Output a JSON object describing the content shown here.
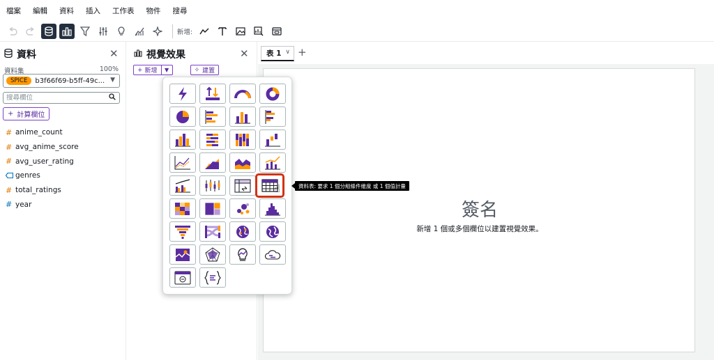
{
  "menu": [
    "檔案",
    "編輯",
    "資料",
    "插入",
    "工作表",
    "物件",
    "搜尋"
  ],
  "toolbar": {
    "new_label": "新增:",
    "icons": [
      "undo-icon",
      "redo-icon",
      "data-icon",
      "visualize-icon",
      "filter-icon",
      "parameters-icon",
      "insights-icon",
      "forecast-icon",
      "ai-icon"
    ],
    "add_icons": [
      "line-chart-icon",
      "text-icon",
      "image-icon",
      "insight-icon",
      "embed-icon"
    ]
  },
  "data_panel": {
    "title": "資料",
    "dataset_label": "資料集",
    "dataset_pct": "100%",
    "spice_badge": "SPICE",
    "dataset_name": "b3f66f69-b5ff-49c...",
    "search_placeholder": "搜尋欄位",
    "calc_button": "計算欄位",
    "fields": [
      {
        "name": "anime_count",
        "type": "measure"
      },
      {
        "name": "avg_anime_score",
        "type": "measure"
      },
      {
        "name": "avg_user_rating",
        "type": "measure"
      },
      {
        "name": "genres",
        "type": "dimension"
      },
      {
        "name": "total_ratings",
        "type": "measure"
      },
      {
        "name": "year",
        "type": "measure-blue"
      }
    ]
  },
  "visuals_panel": {
    "title": "視覺效果",
    "new_button": "新增",
    "build_button": "建置"
  },
  "sheet": {
    "tab_label": "表 1",
    "placeholder_title": "簽名",
    "placeholder_sub": "新增 1 個或多個欄位以建置視覺效果。"
  },
  "picker": {
    "selected": "table",
    "tooltip": "資料表: 要求 1 個分組條件維度 或 1 個值計量"
  },
  "colors": {
    "accent": "#7b40c9",
    "chart_purple": "#5a2ca0",
    "chart_orange": "#ff9900",
    "selected_border": "#d13212"
  }
}
